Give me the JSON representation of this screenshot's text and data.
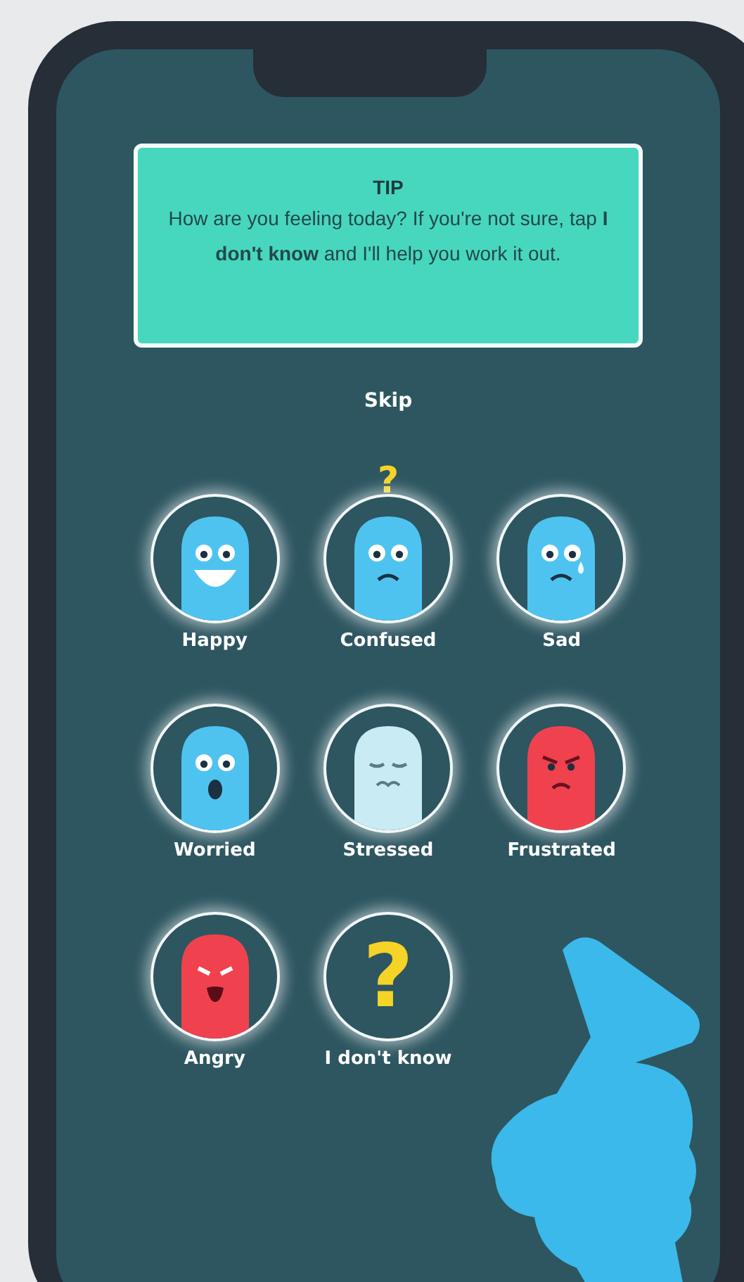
{
  "tip": {
    "title": "TIP",
    "text": "How are you feeling today? If you're not sure, tap **I don't know** and I'll help you work it out."
  },
  "skip": "Skip",
  "moods": [
    {
      "label": "Happy",
      "kind": "smile",
      "color": "#4fc3f0"
    },
    {
      "label": "Confused",
      "kind": "frown",
      "color": "#4fc3f0",
      "symbol": "?"
    },
    {
      "label": "Sad",
      "kind": "tear",
      "color": "#4fc3f0"
    },
    {
      "label": "Worried",
      "kind": "gasp",
      "color": "#4fc3f0"
    },
    {
      "label": "Stressed",
      "kind": "weary",
      "color": "#c9ecf4"
    },
    {
      "label": "Frustrated",
      "kind": "cross",
      "color": "#f0424e"
    },
    {
      "label": "Angry",
      "kind": "shout",
      "color": "#f0424e"
    },
    {
      "label": "I don't know",
      "kind": "unknown",
      "symbol": "?"
    }
  ]
}
